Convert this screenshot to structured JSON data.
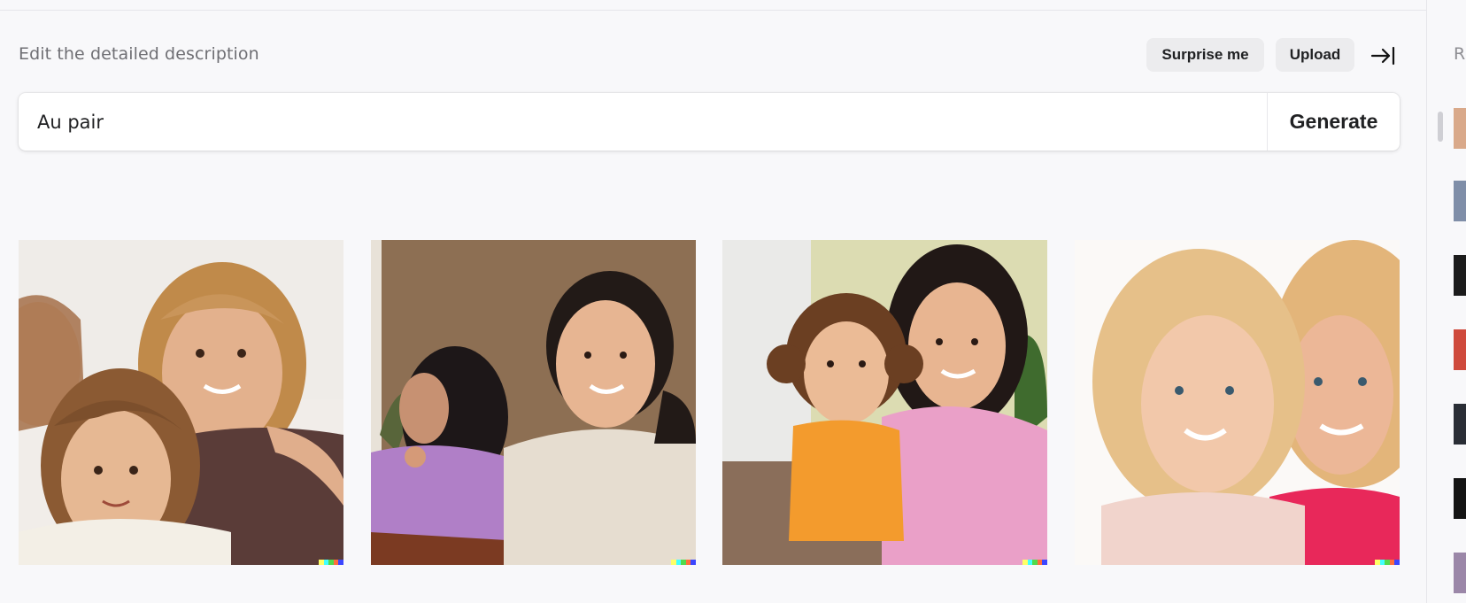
{
  "header": {
    "label": "Edit the detailed description",
    "surprise_label": "Surprise me",
    "upload_label": "Upload"
  },
  "prompt": {
    "value": "Au pair",
    "generate_label": "Generate"
  },
  "results": {
    "images": [
      {
        "name": "Generated image 1"
      },
      {
        "name": "Generated image 2"
      },
      {
        "name": "Generated image 3"
      },
      {
        "name": "Generated image 4"
      }
    ],
    "watermark_colors": [
      "#ffff66",
      "#42ffff",
      "#51da4c",
      "#ff6e3c",
      "#3c46ff"
    ]
  },
  "sidebar": {
    "title_fragment": "R",
    "thumbnails": 8
  },
  "colors": {
    "background": "#f8f8fa",
    "text_muted": "#6f6f74",
    "button_bg": "#ececee",
    "text_primary": "#202123"
  }
}
